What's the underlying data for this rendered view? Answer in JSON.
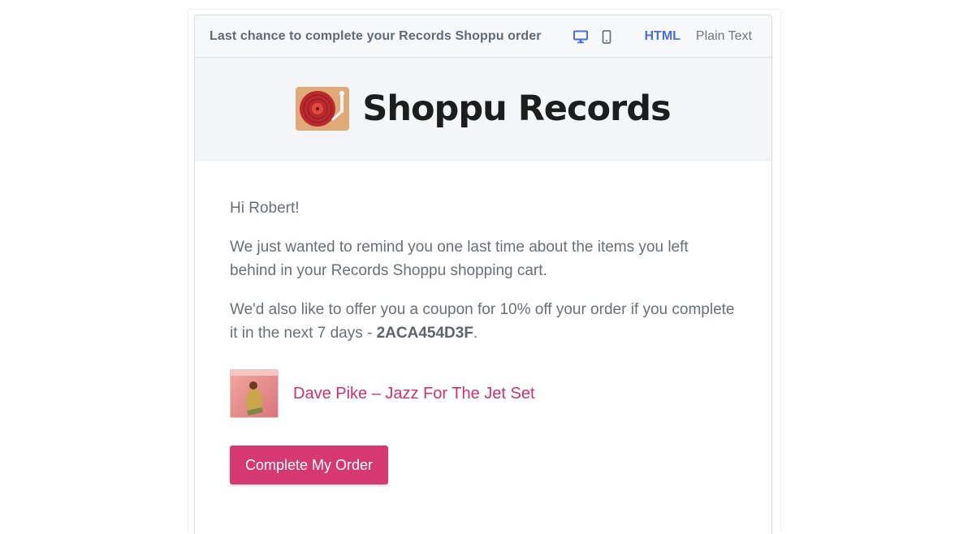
{
  "toolbar": {
    "subject": "Last chance to complete your Records Shoppu order",
    "devices": [
      "desktop-icon",
      "mobile-icon"
    ],
    "tabs": {
      "html": "HTML",
      "plain": "Plain Text"
    },
    "active_tab": "HTML"
  },
  "header": {
    "brand": "Shoppu Records",
    "logo_icon": "turntable-icon"
  },
  "body": {
    "greeting": "Hi Robert!",
    "paragraph1": "We just wanted to remind you one last time about the items you left behind in your Records Shoppu shopping cart.",
    "paragraph2_prefix": "We'd also like to offer you a coupon for 10% off your order if you complete it in the next 7 days - ",
    "coupon_code": "2ACA454D3F",
    "paragraph2_suffix": ".",
    "product_title": "Dave Pike – Jazz For The Jet Set",
    "cta_label": "Complete My Order"
  },
  "colors": {
    "accent": "#d63870",
    "tab_active": "#4a6fdc",
    "text": "#6b6f76"
  }
}
